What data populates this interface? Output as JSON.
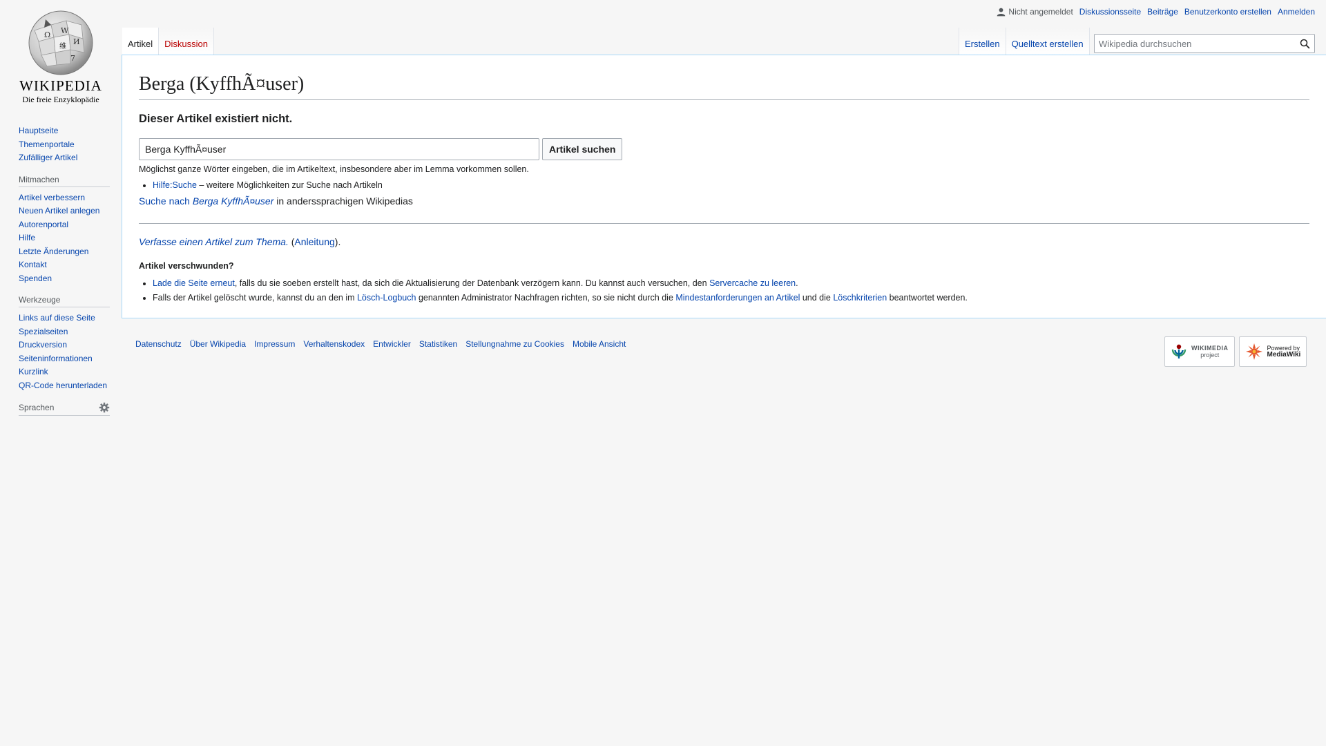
{
  "logo": {
    "wordmark": "WIKIPEDIA",
    "tagline": "Die freie Enzyklopädie",
    "icon": "wikipedia-globe-icon"
  },
  "sidebar": {
    "navigation": [
      {
        "label": "Hauptseite"
      },
      {
        "label": "Themenportale"
      },
      {
        "label": "Zufälliger Artikel"
      }
    ],
    "mitmachen": {
      "heading": "Mitmachen",
      "items": [
        {
          "label": "Artikel verbessern"
        },
        {
          "label": "Neuen Artikel anlegen"
        },
        {
          "label": "Autorenportal"
        },
        {
          "label": "Hilfe"
        },
        {
          "label": "Letzte Änderungen"
        },
        {
          "label": "Kontakt"
        },
        {
          "label": "Spenden"
        }
      ]
    },
    "werkzeuge": {
      "heading": "Werkzeuge",
      "items": [
        {
          "label": "Links auf diese Seite"
        },
        {
          "label": "Spezialseiten"
        },
        {
          "label": "Druckversion"
        },
        {
          "label": "Seiteninformationen"
        },
        {
          "label": "Kurzlink"
        },
        {
          "label": "QR-Code herunterladen"
        }
      ]
    },
    "sprachen": {
      "heading": "Sprachen",
      "icon": "gear-icon"
    }
  },
  "personal": {
    "not_logged_in": "Nicht angemeldet",
    "talk": "Diskussionsseite",
    "contributions": "Beiträge",
    "create_account": "Benutzerkonto erstellen",
    "login": "Anmelden",
    "icon": "user-icon"
  },
  "tabs": {
    "article": "Artikel",
    "discussion": "Diskussion",
    "create": "Erstellen",
    "create_source": "Quelltext erstellen"
  },
  "search": {
    "placeholder": "Wikipedia durchsuchen",
    "icon": "search-icon"
  },
  "content": {
    "title": "Berga (KyffhÃ¤user)",
    "heading": "Dieser Artikel existiert nicht.",
    "search_value": "Berga KyffhÃ¤user",
    "search_button": "Artikel suchen",
    "hint": "Möglichst ganze Wörter eingeben, die im Artikeltext, insbesondere aber im Lemma vorkommen sollen.",
    "help_link": "Hilfe:Suche",
    "help_text": " – weitere Möglichkeiten zur Suche nach Artikeln",
    "interwiki_prefix": "Suche nach ",
    "interwiki_term": "Berga KyffhÃ¤user",
    "interwiki_suffix": " in anderssprachigen Wikipedias",
    "create_link": "Verfasse einen Artikel zum Thema.",
    "create_open": " (",
    "create_help": "Anleitung",
    "create_close": ").",
    "vanished_heading": "Artikel verschwunden?",
    "b1_link": "Lade die Seite erneut",
    "b1_text": ", falls du sie soeben erstellt hast, da sich die Aktualisierung der Datenbank verzögern kann. Du kannst auch versuchen, den ",
    "b1_link2": "Servercache zu leeren",
    "b1_end": ".",
    "b2_text1": "Falls der Artikel gelöscht wurde, kannst du an den im ",
    "b2_link1": "Lösch-Logbuch",
    "b2_text2": " genannten Administrator Nachfragen richten, so sie nicht durch die ",
    "b2_link2": "Mindestanforderungen an Artikel",
    "b2_text3": " und die ",
    "b2_link3": "Löschkriterien",
    "b2_text4": " beantwortet werden."
  },
  "footer": {
    "links": [
      {
        "label": "Datenschutz"
      },
      {
        "label": "Über Wikipedia"
      },
      {
        "label": "Impressum"
      },
      {
        "label": "Verhaltenskodex"
      },
      {
        "label": "Entwickler"
      },
      {
        "label": "Statistiken"
      },
      {
        "label": "Stellungnahme zu Cookies"
      },
      {
        "label": "Mobile Ansicht"
      }
    ],
    "wikimedia_badge": {
      "line1": "WIKIMEDIA",
      "line2": "project",
      "icon": "wikimedia-logo-icon"
    },
    "mediawiki_badge": {
      "line1": "Powered by",
      "line2": "MediaWiki",
      "icon": "mediawiki-logo-icon"
    }
  },
  "colors": {
    "link": "#0645ad",
    "redlink": "#ba0000",
    "border": "#a7d7f9"
  }
}
